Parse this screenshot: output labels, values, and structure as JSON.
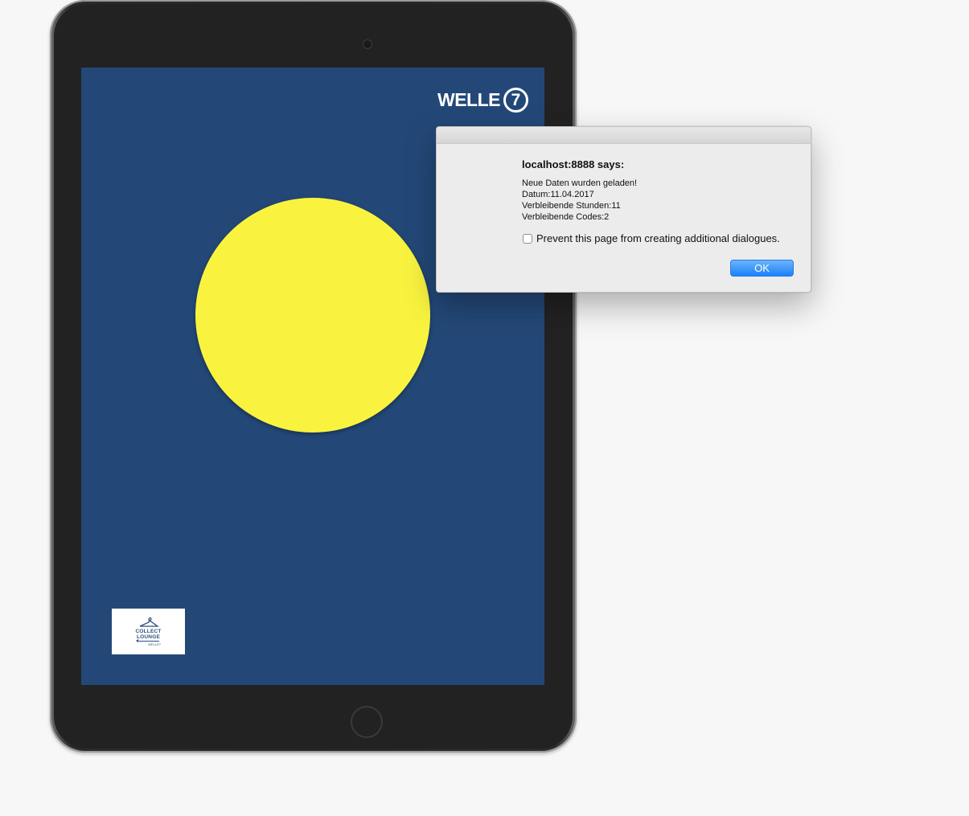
{
  "tablet_app": {
    "logo": {
      "wordmark": "WELLE",
      "numeral": "7"
    },
    "background_color": "#234878",
    "indicator_color": "#f9f33f",
    "sponsor": {
      "line1": "COLLECT",
      "line2": "LOUNGE",
      "subtitle": "WELLE7"
    }
  },
  "dialog": {
    "title": "localhost:8888 says:",
    "message_lines": [
      "Neue Daten wurden geladen!",
      "Datum:11.04.2017",
      "Verbleibende Stunden:11",
      "Verbleibende Codes:2"
    ],
    "checkbox_label": "Prevent this page from creating additional dialogues.",
    "checkbox_checked": false,
    "ok_label": "OK"
  }
}
